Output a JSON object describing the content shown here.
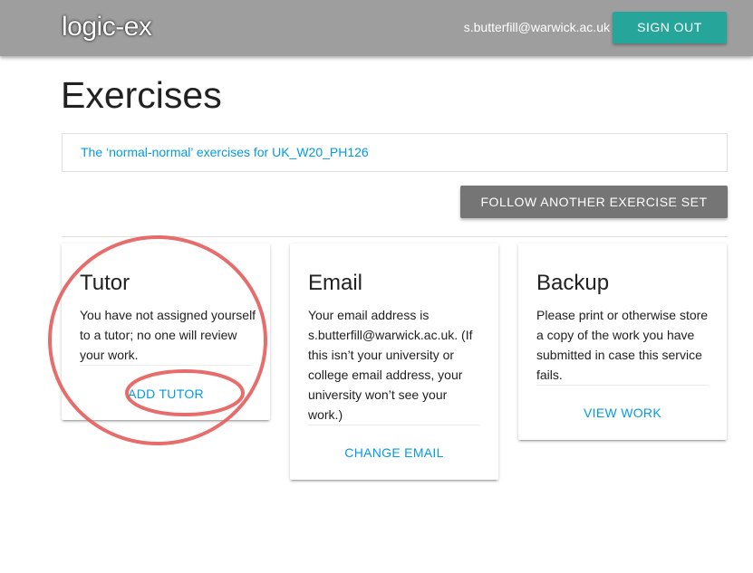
{
  "header": {
    "logo": "logic-ex",
    "user_email": "s.butterfill@warwick.ac.uk",
    "signout_label": "Sign out"
  },
  "main": {
    "title": "Exercises",
    "exercise_sets": [
      {
        "label": "The ‘normal-normal’ exercises for UK_W20_PH126"
      }
    ],
    "follow_button_label": "FOLLOW ANOTHER EXERCISE SET"
  },
  "cards": {
    "tutor": {
      "title": "Tutor",
      "text": "You have not assigned yourself to a tutor; no one will review your work.",
      "action_label": "Add tutor"
    },
    "email": {
      "title": "Email",
      "text": "Your email address is s.butterfill@warwick.ac.uk. (If this isn’t your university or college email address, your university won’t see your work.)",
      "action_label": "Change email"
    },
    "backup": {
      "title": "Backup",
      "text": "Please print or otherwise store a copy of the work you have submitted in case this service fails.",
      "action_label": "View work"
    }
  },
  "colors": {
    "header_bg": "#9e9e9e",
    "accent_teal": "#26a69a",
    "link_blue": "#039be5",
    "button_grey": "#757575",
    "annotation_red": "#e35d5b"
  },
  "icons": [
    "annotation-circle-icon"
  ]
}
